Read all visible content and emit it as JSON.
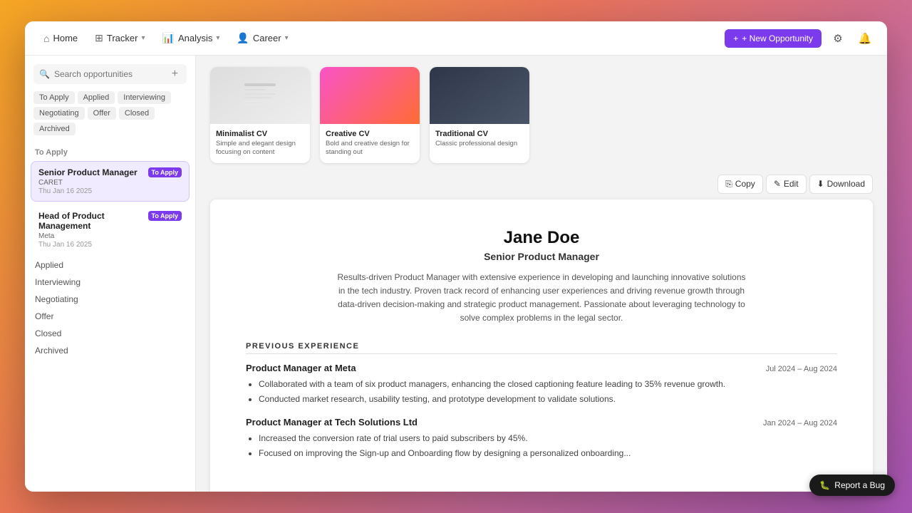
{
  "nav": {
    "home": "Home",
    "tracker": "Tracker",
    "analysis": "Analysis",
    "career": "Career",
    "new_opportunity": "+ New Opportunity"
  },
  "sidebar": {
    "search_placeholder": "Search opportunities",
    "filters": [
      {
        "label": "To Apply",
        "state": "inactive"
      },
      {
        "label": "Applied",
        "state": "inactive"
      },
      {
        "label": "Interviewing",
        "state": "inactive"
      },
      {
        "label": "Negotiating",
        "state": "inactive"
      },
      {
        "label": "Offer",
        "state": "inactive"
      },
      {
        "label": "Closed",
        "state": "inactive"
      },
      {
        "label": "Archived",
        "state": "inactive"
      }
    ],
    "section_to_apply": "To Apply",
    "jobs_to_apply": [
      {
        "title": "Senior Product Manager",
        "company": "CARET",
        "date": "Thu Jan 16 2025",
        "status": "To Apply",
        "active": true
      },
      {
        "title": "Head of Product Management",
        "company": "Meta",
        "date": "Thu Jan 16 2025",
        "status": "To Apply",
        "active": false
      }
    ],
    "links": [
      "Applied",
      "Interviewing",
      "Negotiating",
      "Offer",
      "Closed",
      "Archived"
    ]
  },
  "cv_selector": {
    "cards": [
      {
        "id": "minimalist",
        "title": "Minimalist CV",
        "description": "Simple and elegant design focusing on content",
        "theme": "minimalist"
      },
      {
        "id": "creative",
        "title": "Creative CV",
        "description": "Bold and creative design for standing out",
        "theme": "creative"
      },
      {
        "id": "traditional",
        "title": "Traditional CV",
        "description": "Classic professional design",
        "theme": "traditional"
      }
    ]
  },
  "toolbar": {
    "copy_label": "Copy",
    "edit_label": "Edit",
    "download_label": "Download"
  },
  "resume": {
    "name": "Jane Doe",
    "title": "Senior Product Manager",
    "summary": "Results-driven Product Manager with extensive experience in developing and launching innovative solutions in the tech industry. Proven track record of enhancing user experiences and driving revenue growth through data-driven decision-making and strategic product management. Passionate about leveraging technology to solve complex problems in the legal sector.",
    "sections": {
      "previous_experience": {
        "label": "PREVIOUS EXPERIENCE",
        "items": [
          {
            "title": "Product Manager at Meta",
            "date_range": "Jul 2024 – Aug 2024",
            "bullets": [
              "Collaborated with a team of six product managers, enhancing the closed captioning feature leading to 35% revenue growth.",
              "Conducted market research, usability testing, and prototype development to validate solutions."
            ]
          },
          {
            "title": "Product Manager at Tech Solutions Ltd",
            "date_range": "Jan 2024 – Aug 2024",
            "bullets": [
              "Increased the conversion rate of trial users to paid subscribers by 45%.",
              "Focused on improving the Sign-up and Onboarding flow by designing a personalized onboarding..."
            ]
          }
        ]
      }
    }
  },
  "report_bug": {
    "label": "Report a Bug",
    "icon": "🐛"
  }
}
